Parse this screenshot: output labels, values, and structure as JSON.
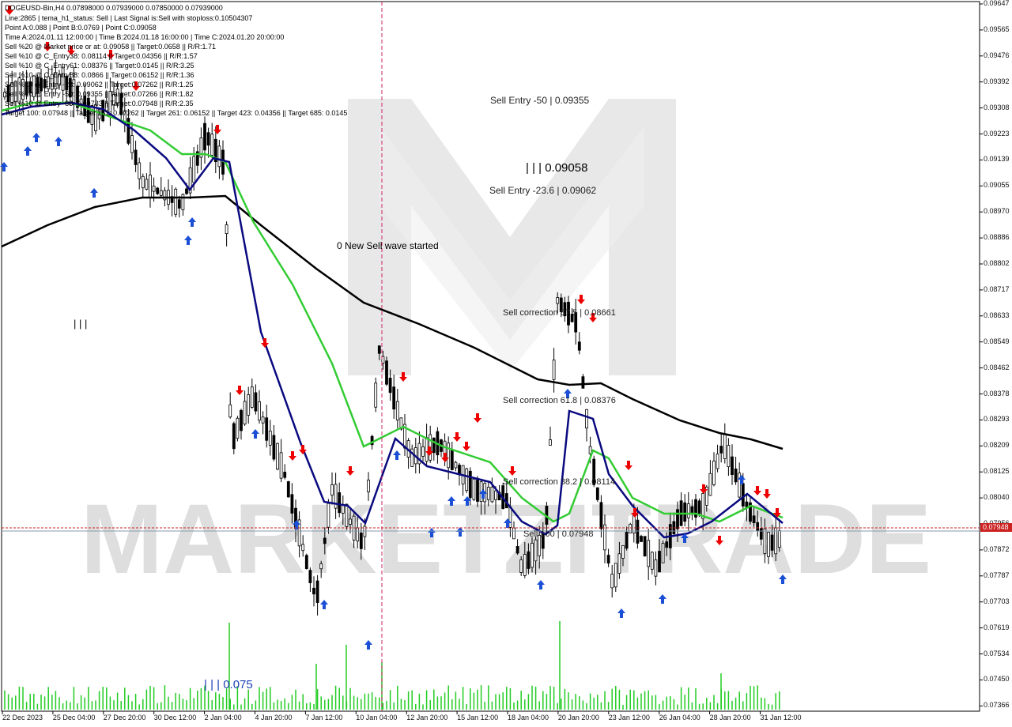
{
  "header": {
    "symbol_line": "DOGEUSD-Bin,H4  0.07898000 0.07939000 0.07850000 0.07939000",
    "lines": [
      "Line:2865 | tema_h1_status: Sell | Last Signal is:Sell with stoploss:0.10504307",
      "Point A:0.088 | Point B:0.0769 | Point C:0.09058",
      "Time A:2024.01.11 12:00:00 | Time B:2024.01.18 16:00:00 | Time C:2024.01.20 20:00:00",
      "Sell %20 @ Market price or at: 0.09058 || Target:0.0658 || R/R:1.71",
      "Sell %10 @ C_Entry38: 0.08114 || Target:0.04356 || R/R:1.57",
      "Sell %10 @ C_Entry61: 0.08376 || Target:0.0145 || R/R:3.25",
      "Sell %10 @ C_Entry88: 0.0866 || Target:0.06152 || R/R:1.36",
      "Sell %10 @ Entry -23: 0.09062 || Target:0.07262 || R/R:1.25",
      "Sell %10 @ Entry -50: 0.09355 || Target:0.07266 || R/R:1.82",
      "Sell %10 @ Entry -88: 0.09783 || Target:0.07948 || R/R:2.35",
      "Target 100: 0.07948 || Target 161: 0.07262 || Target 261: 0.06152 || Target 423: 0.04356 || Target 685: 0.0145"
    ]
  },
  "annotations": {
    "sell_entry_50": "Sell Entry -50 | 0.09355",
    "point_c": "| | | 0.09058",
    "sell_entry_23": "Sell Entry -23.6 | 0.09062",
    "new_wave": "0 New Sell wave started",
    "corr_88": "Sell correction 87.5 | 0.08661",
    "corr_61": "Sell correction 61.8 | 0.08376",
    "corr_38": "Sell correction 38.2 | 0.08114",
    "sell_100": "Sell 100 | 0.07948",
    "point_b": "| | | 0.075",
    "point_a": "| | |"
  },
  "price_axis": {
    "ticks": [
      "0.09647",
      "0.09565",
      "0.09476",
      "0.09392",
      "0.09308",
      "0.09223",
      "0.09139",
      "0.09055",
      "0.08970",
      "0.08886",
      "0.08802",
      "0.08717",
      "0.08633",
      "0.08549",
      "0.08462",
      "0.08378",
      "0.08293",
      "0.08209",
      "0.08125",
      "0.08040",
      "0.07956",
      "0.07872",
      "0.07787",
      "0.07703",
      "0.07619",
      "0.07534",
      "0.07450",
      "0.07366"
    ],
    "current": "0.07948"
  },
  "time_axis": {
    "ticks": [
      "22 Dec 2023",
      "25 Dec 04:00",
      "27 Dec 20:00",
      "30 Dec 12:00",
      "2 Jan 04:00",
      "4 Jan 20:00",
      "7 Jan 12:00",
      "10 Jan 04:00",
      "12 Jan 20:00",
      "15 Jan 12:00",
      "18 Jan 04:00",
      "20 Jan 20:00",
      "23 Jan 12:00",
      "26 Jan 04:00",
      "28 Jan 20:00",
      "31 Jan 12:00"
    ]
  },
  "watermark": "MARKETZITRADE",
  "colors": {
    "up_candle": "#ffffff",
    "down_candle": "#000000",
    "ma_fast": "#0a0a80",
    "ma_mid": "#33cc33",
    "ma_slow": "#000000",
    "sell_arrow": "#ee0000",
    "buy_arrow": "#1a4fd6",
    "volume": "#22cc22",
    "price_marker": "#cc2222"
  }
}
